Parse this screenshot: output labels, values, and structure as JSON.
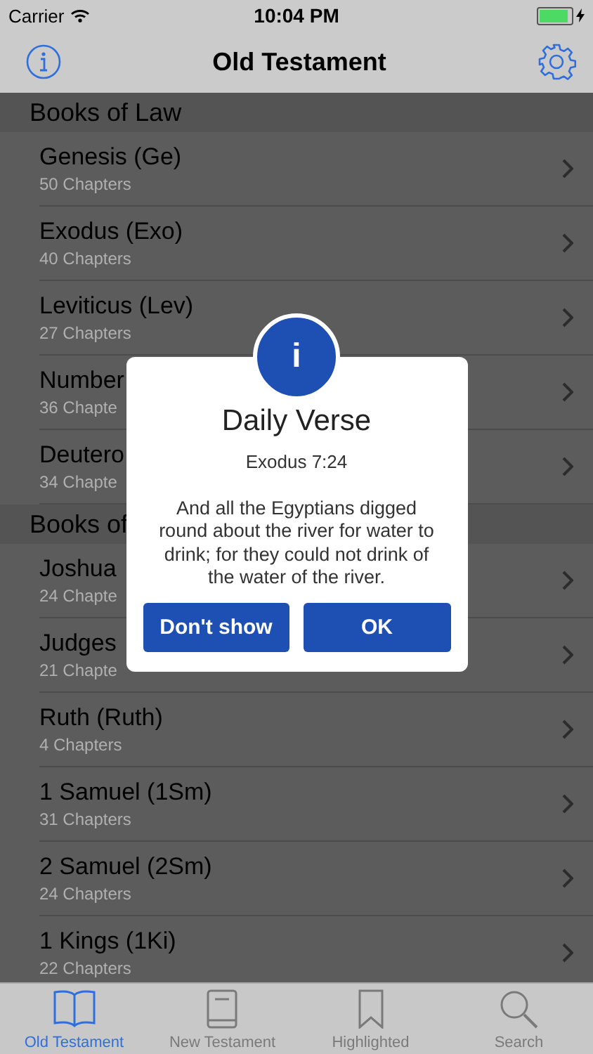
{
  "status_bar": {
    "carrier": "Carrier",
    "time": "10:04 PM"
  },
  "nav": {
    "title": "Old Testament"
  },
  "sections": [
    {
      "title": "Books of Law",
      "books": [
        {
          "name": "Genesis (Ge)",
          "chapters": "50 Chapters"
        },
        {
          "name": "Exodus (Exo)",
          "chapters": "40 Chapters"
        },
        {
          "name": "Leviticus (Lev)",
          "chapters": "27 Chapters"
        },
        {
          "name": "Number",
          "chapters": "36 Chapte"
        },
        {
          "name": "Deutero",
          "chapters": "34 Chapte"
        }
      ]
    },
    {
      "title": "Books of",
      "books": [
        {
          "name": "Joshua",
          "chapters": "24 Chapte"
        },
        {
          "name": "Judges",
          "chapters": "21 Chapte"
        },
        {
          "name": "Ruth (Ruth)",
          "chapters": "4 Chapters"
        },
        {
          "name": "1 Samuel (1Sm)",
          "chapters": "31 Chapters"
        },
        {
          "name": "2 Samuel (2Sm)",
          "chapters": "24 Chapters"
        },
        {
          "name": "1 Kings (1Ki)",
          "chapters": "22 Chapters"
        }
      ]
    }
  ],
  "dialog": {
    "icon": "i",
    "title": "Daily Verse",
    "reference": "Exodus 7:24",
    "text": "And all the Egyptians digged round about the river for water to drink; for they could not drink of the water of the river.",
    "buttons": [
      "Don't show",
      "OK"
    ]
  },
  "tabs": [
    {
      "label": "Old Testament",
      "kind": "openbook",
      "selected": true
    },
    {
      "label": "New Testament",
      "kind": "book",
      "selected": false
    },
    {
      "label": "Highlighted",
      "kind": "bookmark",
      "selected": false
    },
    {
      "label": "Search",
      "kind": "search",
      "selected": false
    }
  ]
}
